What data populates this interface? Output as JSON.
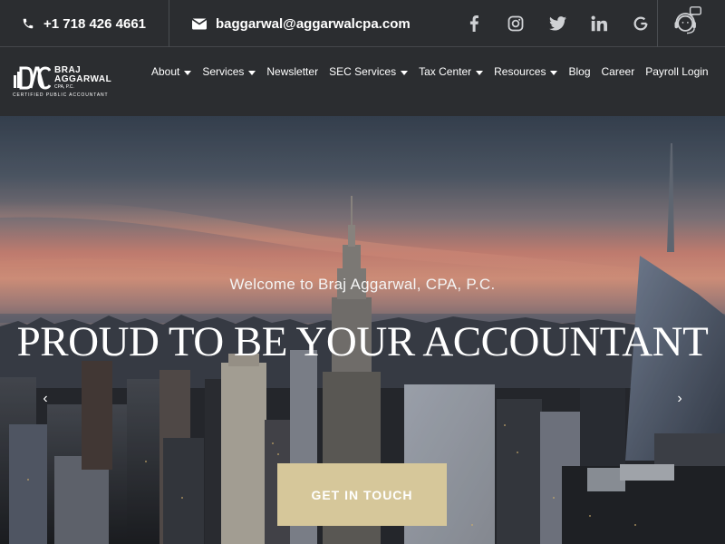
{
  "topbar": {
    "phone": "+1 718 426 4661",
    "email": "baggarwal@aggarwalcpa.com",
    "socials": [
      {
        "name": "facebook-icon",
        "glyph": "f"
      },
      {
        "name": "instagram-icon",
        "glyph": ""
      },
      {
        "name": "twitter-icon",
        "glyph": ""
      },
      {
        "name": "linkedin-icon",
        "glyph": "in"
      },
      {
        "name": "google-icon",
        "glyph": "G"
      }
    ],
    "support_icon": "customer-support-icon"
  },
  "logo": {
    "mark": "BAC",
    "name_line1": "BRAJ",
    "name_line2": "AGGARWAL",
    "suffix": "CPA, P.C.",
    "tagline": "CERTIFIED PUBLIC ACCOUNTANT"
  },
  "nav": {
    "items": [
      {
        "label": "About",
        "dropdown": true
      },
      {
        "label": "Services",
        "dropdown": true
      },
      {
        "label": "Newsletter",
        "dropdown": false
      },
      {
        "label": "SEC Services",
        "dropdown": true
      },
      {
        "label": "Tax Center",
        "dropdown": true
      },
      {
        "label": "Resources",
        "dropdown": true
      },
      {
        "label": "Blog",
        "dropdown": false
      },
      {
        "label": "Career",
        "dropdown": false
      },
      {
        "label": "Payroll Login",
        "dropdown": false
      }
    ]
  },
  "hero": {
    "welcome": "Welcome to Braj Aggarwal, CPA, P.C.",
    "headline": "PROUD TO BE YOUR ACCOUNTANT",
    "cta": "GET IN TOUCH",
    "prev": "‹",
    "next": "›"
  },
  "colors": {
    "bar_bg": "#2b2d30",
    "accent": "#d6c79a",
    "text": "#ffffff"
  }
}
